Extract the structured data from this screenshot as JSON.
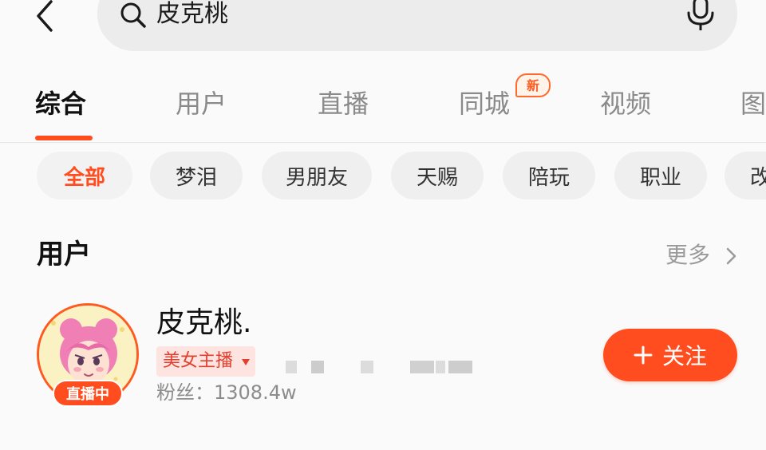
{
  "search": {
    "query": "皮克桃"
  },
  "tabs": [
    {
      "label": "综合",
      "active": true
    },
    {
      "label": "用户"
    },
    {
      "label": "直播"
    },
    {
      "label": "同城",
      "badge": "新"
    },
    {
      "label": "视频"
    },
    {
      "label": "图"
    }
  ],
  "filters": [
    {
      "label": "全部",
      "active": true
    },
    {
      "label": "梦泪"
    },
    {
      "label": "男朋友"
    },
    {
      "label": "天赐"
    },
    {
      "label": "陪玩"
    },
    {
      "label": "职业"
    },
    {
      "label": "改"
    }
  ],
  "users_section": {
    "title": "用户",
    "more_label": "更多",
    "user": {
      "name": "皮克桃.",
      "live_badge": "直播中",
      "tag": "美女主播",
      "fans": "粉丝：1308.4w",
      "follow_label": "关注"
    }
  },
  "colors": {
    "accent": "#ff4d1f",
    "tag_bg": "#fde4e1",
    "tag_text": "#e2402e"
  },
  "icons": [
    "back-icon",
    "search-icon",
    "microphone-icon",
    "chevron-right-icon",
    "plus-icon",
    "dropdown-arrow-icon"
  ]
}
